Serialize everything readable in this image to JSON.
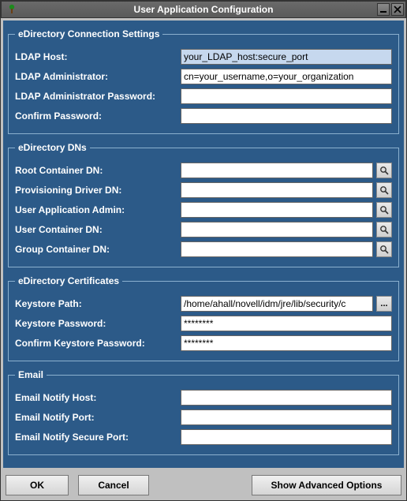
{
  "window": {
    "title": "User Application Configuration"
  },
  "groups": {
    "conn": {
      "legend": "eDirectory Connection Settings",
      "ldap_host_label": "LDAP Host:",
      "ldap_host_value": "your_LDAP_host:secure_port",
      "ldap_admin_label": "LDAP Administrator:",
      "ldap_admin_value": "cn=your_username,o=your_organization",
      "ldap_admin_pw_label": "LDAP Administrator Password:",
      "ldap_admin_pw_value": "",
      "confirm_pw_label": "Confirm Password:",
      "confirm_pw_value": ""
    },
    "dns": {
      "legend": "eDirectory DNs",
      "root_container_label": "Root Container DN:",
      "root_container_value": "",
      "prov_driver_label": "Provisioning Driver DN:",
      "prov_driver_value": "",
      "user_app_admin_label": "User Application Admin:",
      "user_app_admin_value": "",
      "user_container_label": "User Container DN:",
      "user_container_value": "",
      "group_container_label": "Group Container DN:",
      "group_container_value": ""
    },
    "certs": {
      "legend": "eDirectory Certificates",
      "keystore_path_label": "Keystore Path:",
      "keystore_path_value": "/home/ahall/novell/idm/jre/lib/security/c",
      "keystore_pw_label": "Keystore Password:",
      "keystore_pw_value": "********",
      "confirm_keystore_pw_label": "Confirm Keystore Password:",
      "confirm_keystore_pw_value": "********"
    },
    "email": {
      "legend": "Email",
      "host_label": "Email Notify Host:",
      "host_value": "",
      "port_label": "Email Notify Port:",
      "port_value": "",
      "secure_port_label": "Email Notify Secure Port:",
      "secure_port_value": ""
    }
  },
  "buttons": {
    "ok": "OK",
    "cancel": "Cancel",
    "show_advanced": "Show Advanced Options"
  },
  "icons": {
    "app": "tree-icon",
    "minimize": "minimize-icon",
    "close": "close-icon",
    "search": "search-icon",
    "browse": "ellipsis-icon"
  }
}
